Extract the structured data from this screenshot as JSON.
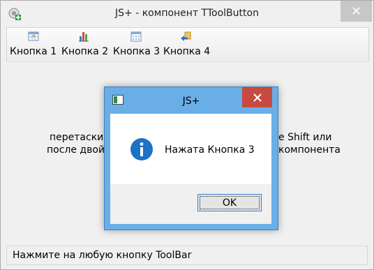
{
  "window": {
    "title": "JS+ - компонент TToolButton",
    "close_glyph": "✕"
  },
  "toolbar": {
    "buttons": [
      {
        "label": "Кнопка 1",
        "icon": "table-icon"
      },
      {
        "label": "Кнопка 2",
        "icon": "bar-chart-icon"
      },
      {
        "label": "Кнопка 3",
        "icon": "calendar-icon"
      },
      {
        "label": "Кнопка 4",
        "icon": "undo-arrow-icon"
      }
    ]
  },
  "client": {
    "line1_left": "перетаскив",
    "line1_right": "e Shift или",
    "line2_left": "после двойн",
    "line2_right": "компонента"
  },
  "statusbar": {
    "text": "Нажмите на любую кнопку ToolBar"
  },
  "dialog": {
    "title": "JS+",
    "message": "Нажата Кнопка 3",
    "ok_label": "OK",
    "icon": "info-icon"
  },
  "colors": {
    "dialog_frame": "#6aaee8",
    "dialog_close": "#c74a40",
    "info_blue": "#1c72c4",
    "focus_border": "#3a7fd2"
  }
}
